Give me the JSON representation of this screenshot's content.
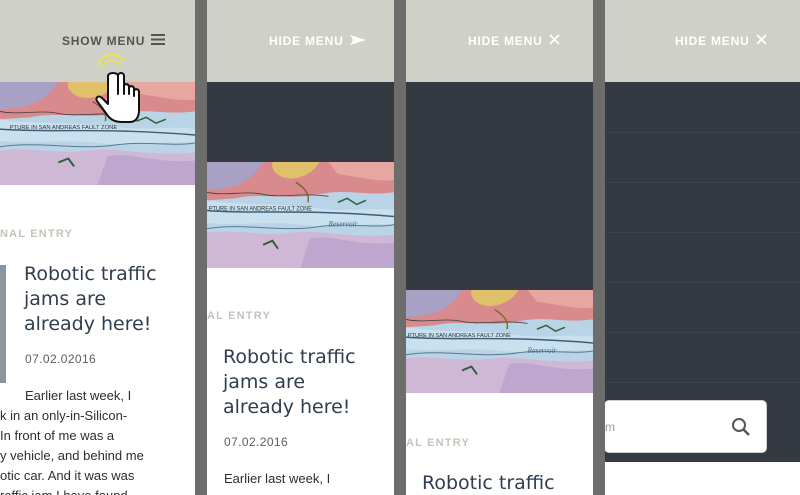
{
  "panels": [
    {
      "menu_label": "SHOW MENU",
      "menu_icon": "hamburger-icon",
      "category": "NAL ENTRY",
      "title_lines": [
        "Robotic traffic",
        "jams are",
        "already here!"
      ],
      "date": "07.02.02016",
      "body_lines": [
        "Earlier last week, I",
        "k in an only-in-Silicon-",
        " In front of me was a",
        "y vehicle, and behind me",
        "otic car.  And it was was",
        "raffic jam I have found"
      ]
    },
    {
      "menu_label": "HIDE MENU",
      "menu_icon": "arrow-right-icon",
      "category": "AL ENTRY",
      "title_lines": [
        "Robotic traffic",
        "jams are",
        "already here!"
      ],
      "date": "07.02.2016",
      "body_lines": [
        "Earlier last week, I"
      ]
    },
    {
      "menu_label": "HIDE MENU",
      "menu_icon": "close-icon",
      "category": "AL ENTRY",
      "title_lines": [
        "Robotic traffic"
      ]
    },
    {
      "menu_label": "HIDE MENU",
      "menu_icon": "close-icon",
      "search_placeholder": "m"
    }
  ],
  "map_label": "PTURE IN SAN ANDREAS FAULT ZONE",
  "map_label_2": "Reservoir",
  "colors": {
    "header_bg": "#cfd0c8",
    "menu_bg": "#343a41",
    "divider": "#6d6d6b",
    "title": "#2f3d4f"
  }
}
